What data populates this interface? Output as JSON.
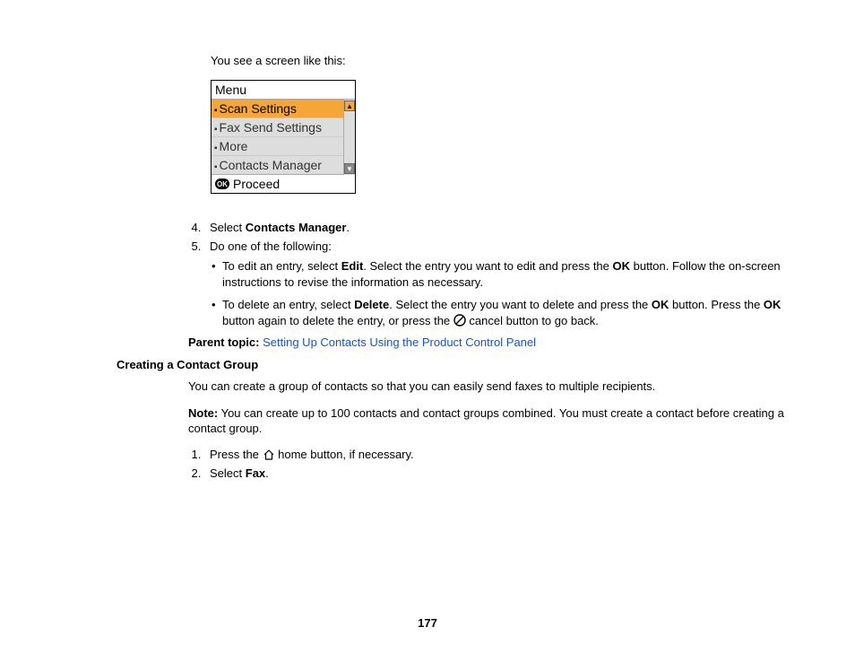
{
  "intro": "You see a screen like this:",
  "menu": {
    "title": "Menu",
    "items": [
      "Scan Settings",
      "Fax Send Settings",
      "More",
      "Contacts Manager"
    ],
    "footer_ok": "OK",
    "footer_text": "Proceed"
  },
  "stepsA": {
    "s4_pre": "Select ",
    "s4_bold": "Contacts Manager",
    "s4_post": ".",
    "s5": "Do one of the following:",
    "b1_pre": "To edit an entry, select ",
    "b1_bold1": "Edit",
    "b1_mid": ". Select the entry you want to edit and press the ",
    "b1_bold2": "OK",
    "b1_post": " button. Follow the on-screen instructions to revise the information as necessary.",
    "b2_pre": "To delete an entry, select ",
    "b2_bold1": "Delete",
    "b2_mid": ". Select the entry you want to delete and press the ",
    "b2_bold2": "OK",
    "b2_mid2": " button. Press the ",
    "b2_bold3": "OK",
    "b2_mid3": " button again to delete the entry, or press the ",
    "b2_post": " cancel button to go back."
  },
  "parent": {
    "label": "Parent topic:",
    "link": "Setting Up Contacts Using the Product Control Panel"
  },
  "section2": {
    "heading": "Creating a Contact Group",
    "p1": "You can create a group of contacts so that you can easily send faxes to multiple recipients.",
    "note_label": "Note:",
    "note_body": " You can create up to 100 contacts and contact groups combined. You must create a contact before creating a contact group.",
    "s1_pre": "Press the ",
    "s1_post": " home button, if necessary.",
    "s2_pre": "Select ",
    "s2_bold": "Fax",
    "s2_post": "."
  },
  "page_number": "177"
}
